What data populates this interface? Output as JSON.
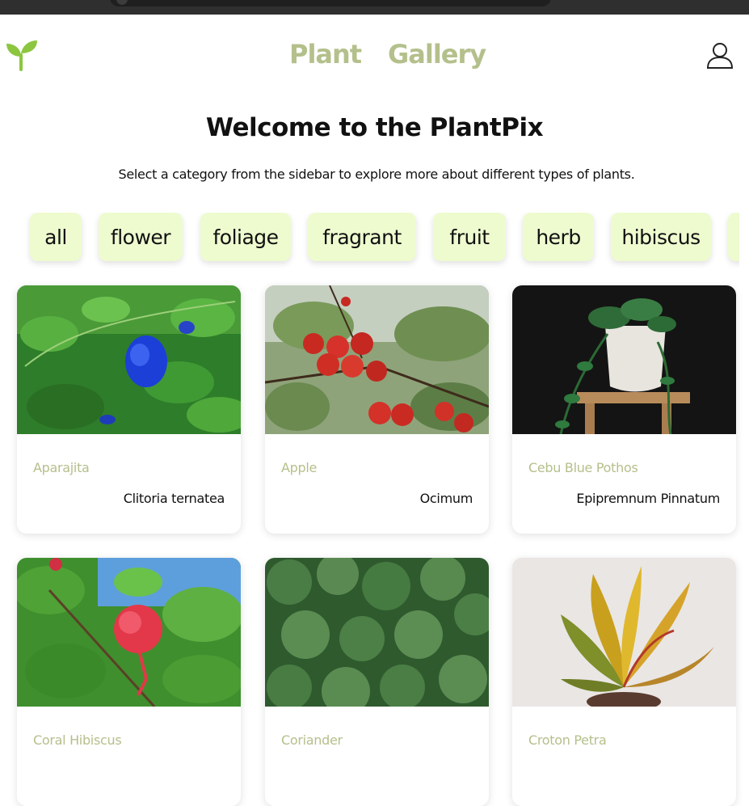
{
  "nav": {
    "links": [
      "Plant",
      "Gallery"
    ]
  },
  "header": {
    "title": "Welcome to the PlantPix",
    "subtitle": "Select a category from the sidebar to explore more about different types of plants."
  },
  "categories": [
    "all",
    "flower",
    "foliage",
    "fragrant",
    "fruit",
    "herb",
    "hibiscus"
  ],
  "plants": [
    {
      "name": "Aparajita",
      "scientific": "Clitoria ternatea"
    },
    {
      "name": "Apple",
      "scientific": "Ocimum"
    },
    {
      "name": "Cebu Blue Pothos",
      "scientific": "Epipremnum Pinnatum"
    },
    {
      "name": "Coral Hibiscus",
      "scientific": ""
    },
    {
      "name": "Coriander",
      "scientific": ""
    },
    {
      "name": "Croton Petra",
      "scientific": ""
    }
  ],
  "colors": {
    "accent": "#b4c08c",
    "chip_bg": "#eefbcf",
    "topbar": "#2f2f2f"
  },
  "icons": {
    "logo": "sprout-icon",
    "user": "user-icon"
  }
}
